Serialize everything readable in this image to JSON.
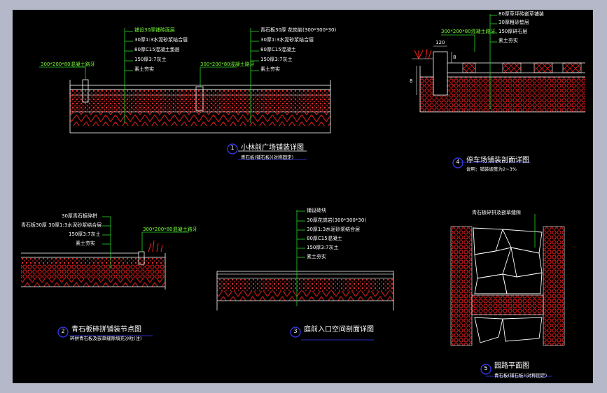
{
  "drawing1": {
    "number": "1",
    "title": "小林前广场铺装详图",
    "subtitle": "青石板(铺石板)(对称固定)",
    "curb_note_left": "300*200*80混凝土路牙",
    "curb_note_right": "300*200*80混凝土路牙",
    "layers_left": [
      "铺设30厚铺砖面层",
      "30厚1:3水泥砂浆结合层",
      "80厚C15混凝土垫层",
      "150厚3:7灰土",
      "素土夯实"
    ],
    "layers_right": [
      "青石板30厚 花岗岩(300*300*30)",
      "30厚1:3水泥砂浆结合层",
      "80厚C15混凝土",
      "150厚3:7灰土",
      "素土夯实"
    ]
  },
  "drawing2": {
    "number": "2",
    "title": "青石板碎拼铺装节点图",
    "subtitle": "碎拼青石板及嵌草缝隙填充沙粒(注)",
    "curb_note": "300*200*80混凝土路牙",
    "layers": [
      "30厚青石板碎拼",
      "青石板30厚 30厚1:3水泥砂浆结合层",
      "150厚3:7灰土",
      "素土夯实"
    ]
  },
  "drawing3": {
    "number": "3",
    "title": "庭前入口空间剖面详图",
    "layers": [
      "铺设砖块",
      "30厚花岗岩(300*300*30)",
      "30厚1:3水泥砂浆结合层",
      "80厚C15混凝土",
      "150厚3:7灰土",
      "素土夯实"
    ]
  },
  "drawing4": {
    "number": "4",
    "title": "停车场铺装剖面详图",
    "subtitle": "说明：铺装坡度为2~3%",
    "curb_note": "300*200*80混凝土路牙",
    "dim_top": "120",
    "dim_small": "8",
    "dim_side": "8",
    "layers": [
      "80厚草坪砖嵌草铺装",
      "30厚粗砂垫层",
      "150厚碎石层",
      "素土夯实"
    ]
  },
  "drawing5": {
    "number": "5",
    "title": "园路平面图",
    "subtitle": "青石板(铺石板)(对称固定)",
    "leader_note": "青石板碎拼及嵌草缝隙"
  },
  "colors": {
    "background": "#000000",
    "frame": "#b4b8c8",
    "hatch": "#ff2020",
    "leader": "#2bd62b",
    "line": "#ffffff",
    "circle": "#3a3aff"
  }
}
